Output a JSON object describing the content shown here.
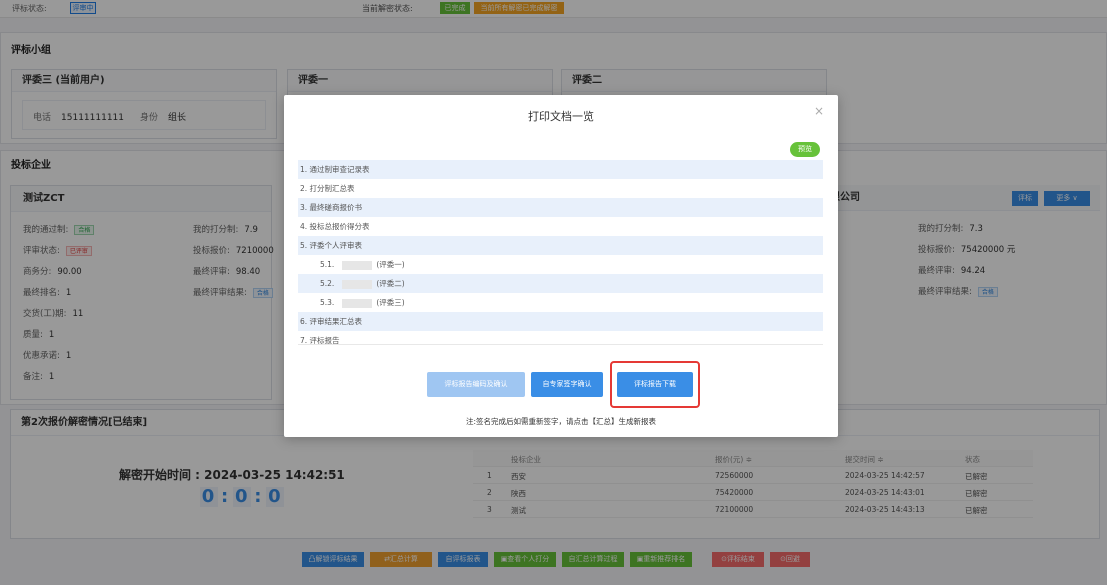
{
  "topstrip": {
    "left_text": "评标状态:",
    "left_badge": "评审中",
    "mid_text": "当前解密状态:",
    "badge_green": "已完成",
    "badge_orange": "当前所有解密已完成解密"
  },
  "panel_group": {
    "title": "评标小组",
    "judges": [
      {
        "name": "评委三 (当前用户)",
        "phone_label": "电话",
        "phone": "15111111111",
        "role_label": "身份",
        "role": "组长"
      },
      {
        "name": "评委一"
      },
      {
        "name": "评委二"
      }
    ]
  },
  "bidders": {
    "title": "投标企业",
    "left": {
      "name": "测试ZCT",
      "pass_label": "我的通过制:",
      "pass_tag": "合格",
      "status_label": "评审状态:",
      "status_tag": "已评审",
      "biz_label": "商务分:",
      "biz": "90.00",
      "rank_label": "最终排名:",
      "rank": "1",
      "delivery_label": "交货(工)期:",
      "delivery": "11",
      "quality_label": "质量:",
      "quality": "1",
      "discount_label": "优惠承诺:",
      "discount": "1",
      "remark_label": "备注:",
      "remark": "1",
      "score_label": "我的打分制:",
      "score": "7.9",
      "price_label": "投标报价:",
      "price": "7210000",
      "final_label": "最终评审:",
      "final": "98.40",
      "result_label": "最终评审结果:",
      "result_tag": "合格"
    },
    "right": {
      "name": "有限公司",
      "btn_eval": "评标",
      "btn_more": "更多 ∨",
      "score_label": "我的打分制:",
      "score": "7.3",
      "price_label": "投标报价:",
      "price": "75420000 元",
      "final_label": "最终评审:",
      "final": "94.24",
      "result_label": "最终评审结果:",
      "result_tag": "合格"
    }
  },
  "decrypt": {
    "title": "第2次报价解密情况[已结束]",
    "start_time": "解密开始时间 : 2024-03-25 14:42:51",
    "timer": [
      "0",
      "0",
      "0"
    ],
    "headers": [
      "投标企业",
      "报价(元) ≑",
      "提交时间 ≑",
      "状态"
    ],
    "rows": [
      {
        "no": "1",
        "company": "西安",
        "price": "72560000",
        "time": "2024-03-25 14:42:57",
        "status": "已解密"
      },
      {
        "no": "2",
        "company": "陕西",
        "price": "75420000",
        "time": "2024-03-25 14:43:01",
        "status": "已解密"
      },
      {
        "no": "3",
        "company": "测试",
        "price": "72100000",
        "time": "2024-03-25 14:43:13",
        "status": "已解密"
      }
    ]
  },
  "bottom_buttons": [
    {
      "label": "凸解锁评标结果",
      "color": "#3a8ee6"
    },
    {
      "label": "⇄汇总计算",
      "color": "#f0a030"
    },
    {
      "label": "自评标报表",
      "color": "#3a8ee6"
    },
    {
      "label": "▣查看个人打分",
      "color": "#67c23a"
    },
    {
      "label": "自汇总计算过程",
      "color": "#67c23a"
    },
    {
      "label": "▣重新推荐排名",
      "color": "#67c23a"
    },
    {
      "label": "⊙评标结束",
      "color": "#f56c6c"
    },
    {
      "label": "⊙回避",
      "color": "#f56c6c"
    }
  ],
  "dialog": {
    "title": "打印文档一览",
    "close": "×",
    "preview": "预览",
    "docs": [
      {
        "label": "1. 通过制审查记录表",
        "sub": false
      },
      {
        "label": "2. 打分制汇总表",
        "sub": false
      },
      {
        "label": "3. 最终磋商报价书",
        "sub": false
      },
      {
        "label": "4. 投标总报价得分表",
        "sub": false
      },
      {
        "label": "5. 评委个人评审表",
        "sub": false
      },
      {
        "label": "5.1.",
        "suffix": "(评委一)",
        "sub": true
      },
      {
        "label": "5.2.",
        "suffix": "(评委二)",
        "sub": true
      },
      {
        "label": "5.3.",
        "suffix": "(评委三)",
        "sub": true
      },
      {
        "label": "6. 评审结果汇总表",
        "sub": false
      },
      {
        "label": "7. 评标报告",
        "sub": false
      }
    ],
    "btn_confirm": "评标报告编码及确认",
    "btn_sign": "自专家签字确认",
    "btn_download": "评标报告下载",
    "note": "注:签名完成后如需重新签字，请点击【汇总】生成新报表"
  },
  "colors": {
    "primary": "#3a8ee6",
    "success": "#67c23a",
    "danger": "#f56c6c",
    "highlight": "#e53935"
  }
}
